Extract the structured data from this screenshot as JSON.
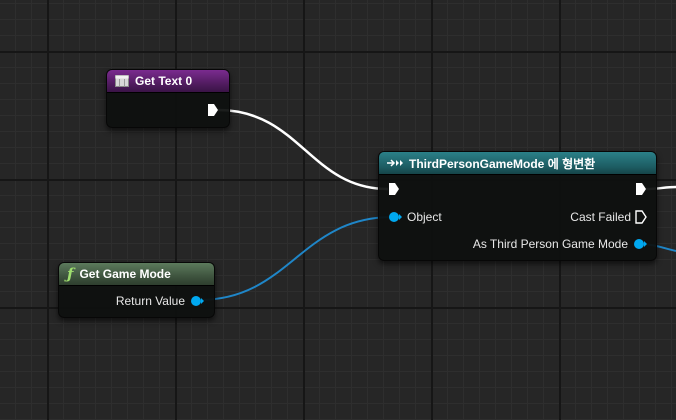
{
  "nodes": {
    "get_text": {
      "title": "Get Text 0"
    },
    "get_game_mode": {
      "title": "Get Game Mode",
      "icon": "function-icon",
      "output_label": "Return Value"
    },
    "cast": {
      "title": "ThirdPersonGameMode 에 형변환",
      "icon": "cast-icon",
      "input_label": "Object",
      "cast_failed_label": "Cast Failed",
      "output_label": "As Third Person Game Mode"
    }
  },
  "colors": {
    "exec_wire": "#ffffff",
    "object_pin": "#00a8f0",
    "object_wire": "#1f86c8",
    "text_header": "#7a2b8f",
    "function_header": "#5c7a5c",
    "cast_header": "#2b8088"
  }
}
